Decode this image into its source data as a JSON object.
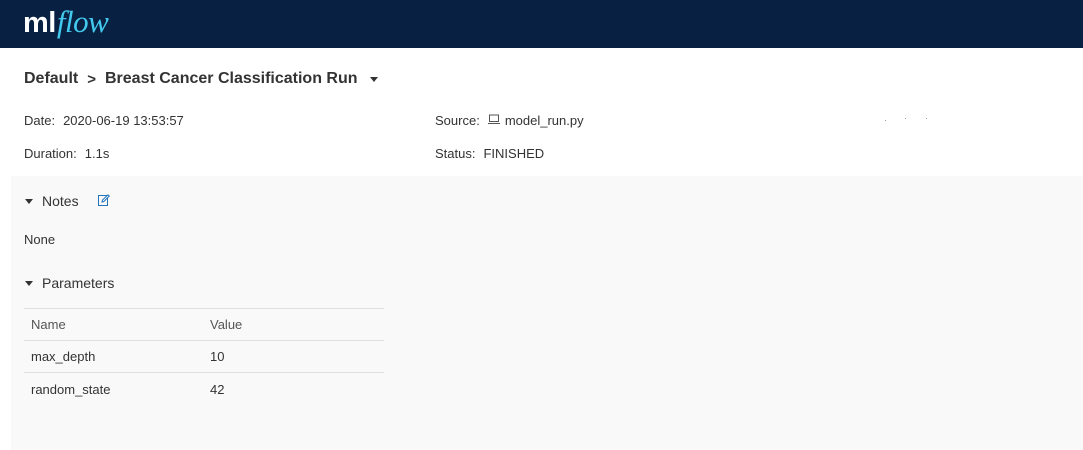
{
  "app": {
    "logo_ml": "ml",
    "logo_flow": "flow"
  },
  "breadcrumb": {
    "experiment": "Default",
    "separator": ">",
    "run_name": "Breast Cancer Classification Run"
  },
  "run_info": {
    "date_label": "Date:",
    "date_value": "2020-06-19 13:53:57",
    "duration_label": "Duration:",
    "duration_value": "1.1s",
    "source_label": "Source:",
    "source_value": "model_run.py",
    "status_label": "Status:",
    "status_value": "FINISHED"
  },
  "notes": {
    "title": "Notes",
    "value": "None"
  },
  "parameters": {
    "title": "Parameters",
    "columns": [
      "Name",
      "Value"
    ],
    "rows": [
      {
        "name": "max_depth",
        "value": "10"
      },
      {
        "name": "random_state",
        "value": "42"
      }
    ]
  },
  "icons": {
    "section_toggle": "caret-down-icon",
    "edit": "edit-icon",
    "source": "monitor-icon"
  },
  "colors": {
    "topbar": "#082142",
    "logo_accent": "#43c9ed",
    "edit_icon": "#2374bb",
    "panel_bg": "#f9f9f9"
  }
}
